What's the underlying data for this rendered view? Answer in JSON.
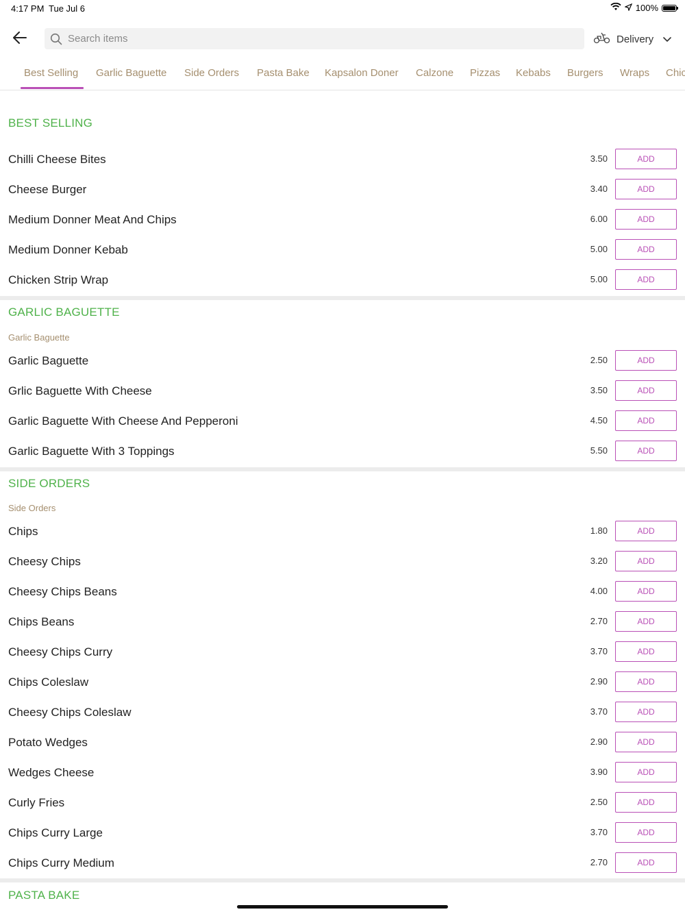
{
  "status_bar": {
    "time": "4:17 PM",
    "date": "Tue Jul 6",
    "battery": "100%",
    "battery_level": 1.0
  },
  "header": {
    "search_placeholder": "Search items",
    "delivery_label": "Delivery"
  },
  "tabs": [
    "Best Selling",
    "Garlic Baguette",
    "Side Orders",
    "Pasta Bake",
    "Kapsalon Doner",
    "Calzone",
    "Pizzas",
    "Kebabs",
    "Burgers",
    "Wraps",
    "Chic"
  ],
  "active_tab": "Best Selling",
  "add_label": "ADD",
  "sections": [
    {
      "title": "BEST SELLING",
      "items": [
        {
          "name": "Chilli Cheese Bites",
          "price": "3.50"
        },
        {
          "name": "Cheese Burger",
          "price": "3.40"
        },
        {
          "name": "Medium Donner Meat And Chips",
          "price": "6.00"
        },
        {
          "name": "Medium Donner Kebab",
          "price": "5.00"
        },
        {
          "name": "Chicken Strip Wrap",
          "price": "5.00"
        }
      ]
    },
    {
      "title": "GARLIC BAGUETTE",
      "subtitle": "Garlic Baguette",
      "items": [
        {
          "name": "Garlic Baguette",
          "price": "2.50"
        },
        {
          "name": "Grlic Baguette With Cheese",
          "price": "3.50"
        },
        {
          "name": "Garlic Baguette With Cheese And Pepperoni",
          "price": "4.50"
        },
        {
          "name": "Garlic Baguette With 3 Toppings",
          "price": "5.50"
        }
      ]
    },
    {
      "title": "SIDE ORDERS",
      "subtitle": "Side Orders",
      "items": [
        {
          "name": "Chips",
          "price": "1.80"
        },
        {
          "name": "Cheesy Chips",
          "price": "3.20"
        },
        {
          "name": "Cheesy Chips Beans",
          "price": "4.00"
        },
        {
          "name": "Chips Beans",
          "price": "2.70"
        },
        {
          "name": "Cheesy Chips Curry",
          "price": "3.70"
        },
        {
          "name": "Chips Coleslaw",
          "price": "2.90"
        },
        {
          "name": "Cheesy Chips Coleslaw",
          "price": "3.70"
        },
        {
          "name": "Potato Wedges",
          "price": "2.90"
        },
        {
          "name": "Wedges Cheese",
          "price": "3.90"
        },
        {
          "name": "Curly Fries",
          "price": "2.50"
        },
        {
          "name": "Chips Curry Large",
          "price": "3.70"
        },
        {
          "name": "Chips Curry Medium",
          "price": "2.70"
        }
      ]
    },
    {
      "title": "PASTA BAKE",
      "items": []
    }
  ],
  "colors": {
    "accent": "#b94fb6",
    "section_title": "#4fb24a",
    "tab_text": "#a58f6f"
  },
  "icons": {
    "back": "arrow-left-icon",
    "search": "search-icon",
    "delivery": "scooter-icon",
    "chevron": "chevron-down-icon"
  }
}
